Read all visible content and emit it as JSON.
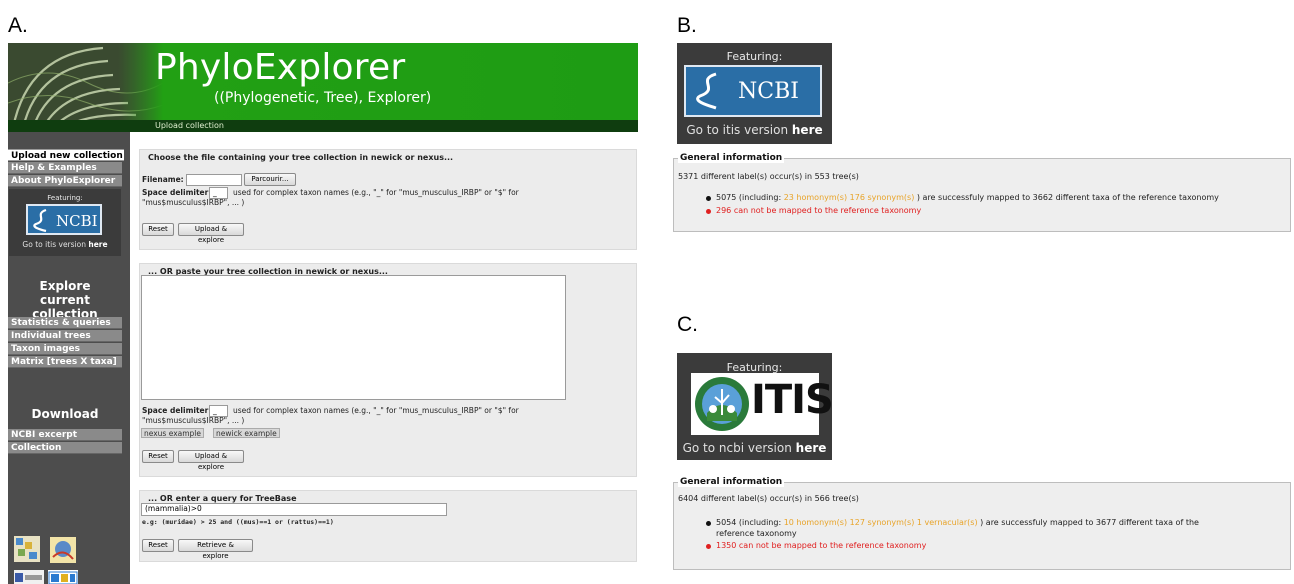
{
  "panels": {
    "a_label": "A.",
    "b_label": "B.",
    "c_label": "C."
  },
  "app": {
    "title": "PhyloExplorer",
    "subtitle": "((Phylogenetic, Tree), Explorer)",
    "breadcrumb": "Upload collection"
  },
  "sidebar": {
    "items_top": [
      {
        "label": "Upload new collection"
      },
      {
        "label": "Help & Examples"
      },
      {
        "label": "About PhyloExplorer"
      }
    ],
    "explore_heading": "Explore current collection",
    "explore_items": [
      {
        "label": "Statistics & queries"
      },
      {
        "label": "Individual trees"
      },
      {
        "label": "Taxon images"
      },
      {
        "label": "Matrix [trees X taxa]"
      }
    ],
    "download_heading": "Download",
    "download_items": [
      {
        "label": "NCBI excerpt"
      },
      {
        "label": "Collection"
      }
    ],
    "badge": {
      "featuring": "Featuring:",
      "logo": "NCBI",
      "goto_prefix": "Go to itis version",
      "goto_link": "here"
    }
  },
  "upload_file": {
    "title": "Choose the file containing your tree collection in newick or nexus...",
    "filename_label": "Filename:",
    "browse_label": "Parcourir...",
    "delimiter_label": "Space delimiter:",
    "delimiter_value": "_",
    "delimiter_help_1": "used for complex taxon names (e.g., \"_\" for \"mus_musculus_IRBP\" or \"$\" for",
    "delimiter_help_2": "\"mus$musculus$IRBP\", ... )",
    "reset_label": "Reset",
    "submit_label": "Upload & explore"
  },
  "paste": {
    "title": "... OR paste your tree collection in newick or nexus...",
    "delimiter_label": "Space delimiter:",
    "delimiter_value": "_",
    "delimiter_help_1": "used for complex taxon names (e.g., \"_\" for \"mus_musculus_IRBP\" or \"$\" for",
    "delimiter_help_2": "\"mus$musculus$IRBP\", ... )",
    "nexus_example": "nexus example",
    "newick_example": "newick example",
    "reset_label": "Reset",
    "submit_label": "Upload & explore"
  },
  "treebase": {
    "title": "... OR enter a query for TreeBase",
    "query_value": "(mammalia)>0",
    "example": "e.g: (muridae) > 25 and ((mus)==1 or (rattus)==1)",
    "reset_label": "Reset",
    "submit_label": "Retrieve & explore"
  },
  "panel_b": {
    "featuring": "Featuring:",
    "logo": "NCBI",
    "goto_prefix": "Go to itis version",
    "goto_link": "here",
    "legend": "General information",
    "summary": "5371 different label(s) occur(s) in 553 tree(s)",
    "mapped_count": "5075 (including:",
    "homonyms": "23 homonym(s)",
    "synonyms": "176 synonym(s)",
    "mapped_suffix": ") are successfuly mapped to 3662 different taxa of the reference taxonomy",
    "unmapped": "296 can not be mapped to the reference taxonomy"
  },
  "panel_c": {
    "featuring": "Featuring:",
    "logo": "ITIS",
    "goto_prefix": "Go to ncbi version",
    "goto_link": "here",
    "legend": "General information",
    "summary": "6404 different label(s) occur(s) in 566 tree(s)",
    "mapped_count": "5054 (including:",
    "homonyms": "10 homonym(s)",
    "synonyms": "127 synonym(s)",
    "vernacular": "1 vernacular(s)",
    "mapped_suffix": ") are successfuly mapped to 3677 different taxa of the",
    "mapped_suffix_2": "reference taxonomy",
    "unmapped": "1350 can not be mapped to the reference taxonomy"
  },
  "colors": {
    "header_green": "#1e9c14",
    "sidebar_gray": "#4d4d4d",
    "ncbi_blue": "#2a6ea6",
    "homonym_orange": "#e8a42a",
    "error_red": "#e02020"
  }
}
